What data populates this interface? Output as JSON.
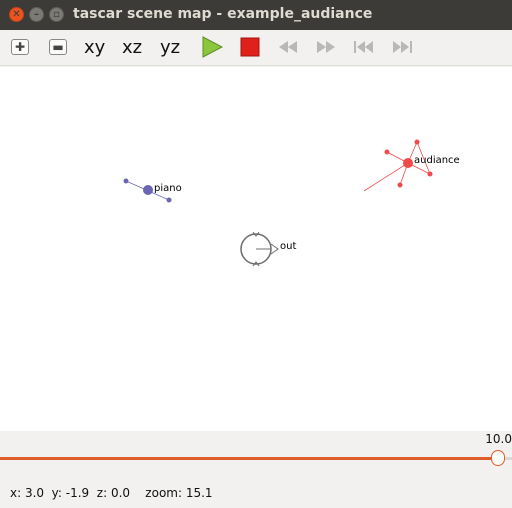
{
  "window": {
    "title": "tascar scene map - example_audiance"
  },
  "toolbar": {
    "zoom_in_icon": "plus-box-icon",
    "zoom_out_icon": "minus-box-icon",
    "view_xy": "xy",
    "view_xz": "xz",
    "view_yz": "yz",
    "play_icon": "play-icon",
    "stop_icon": "stop-icon",
    "rewind_icon": "rewind-icon",
    "forward_icon": "fast-forward-icon",
    "skip_start_icon": "skip-to-start-icon",
    "skip_end_icon": "skip-to-end-icon"
  },
  "scene": {
    "objects": [
      {
        "label": "piano",
        "color": "#6a66b4"
      },
      {
        "label": "audiance",
        "color": "#f04a4a"
      },
      {
        "label": "out",
        "color": "#6c6c6c"
      }
    ]
  },
  "timeline": {
    "value_text": "10.0",
    "position_fraction": 0.986,
    "accent_color": "#e05d2c"
  },
  "status": {
    "text": "x: 3.0  y: -1.9  z: 0.0    zoom: 15.1"
  }
}
